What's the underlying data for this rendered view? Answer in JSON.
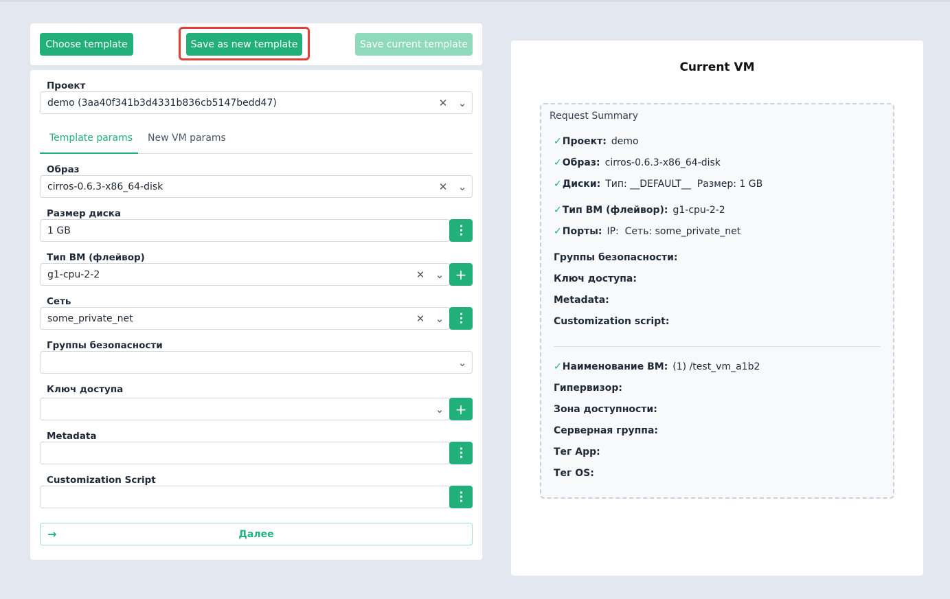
{
  "toolbar": {
    "choose_label": "Choose template",
    "save_as_new_label": "Save as new template",
    "save_current_label": "Save current template"
  },
  "form": {
    "project": {
      "label": "Проект",
      "value": "demo (3aa40f341b3d4331b836cb5147bedd47)"
    },
    "tabs": [
      {
        "label": "Template params",
        "active": true
      },
      {
        "label": "New VM params",
        "active": false
      }
    ],
    "image": {
      "label": "Образ",
      "value": "cirros-0.6.3-x86_64-disk"
    },
    "disk_size": {
      "label": "Размер диска",
      "value": "1 GB"
    },
    "flavor": {
      "label": "Тип ВМ (флейвор)",
      "value": "g1-cpu-2-2"
    },
    "network": {
      "label": "Сеть",
      "value": "some_private_net"
    },
    "security_groups": {
      "label": "Группы безопасности",
      "value": ""
    },
    "access_key": {
      "label": "Ключ доступа",
      "value": ""
    },
    "metadata": {
      "label": "Metadata",
      "value": ""
    },
    "customization": {
      "label": "Customization Script",
      "value": ""
    },
    "next_label": "Далее"
  },
  "summary": {
    "title": "Current VM",
    "box_title": "Request Summary",
    "rows": [
      {
        "checked": true,
        "key": "Проект:",
        "value": "demo"
      },
      {
        "checked": true,
        "key": "Образ:",
        "value": "cirros-0.6.3-x86_64-disk"
      },
      {
        "checked": true,
        "key": "Диски:",
        "value": "Тип: __DEFAULT__  Размер: 1 GB"
      },
      {
        "checked": true,
        "key": "Тип ВМ (флейвор):",
        "value": "g1-cpu-2-2"
      },
      {
        "checked": true,
        "key": "Порты:",
        "value": "IP:  Сеть: some_private_net"
      },
      {
        "checked": false,
        "key": "Группы безопасности:",
        "value": ""
      },
      {
        "checked": false,
        "key": "Ключ доступа:",
        "value": ""
      },
      {
        "checked": false,
        "key": "Metadata:",
        "value": ""
      },
      {
        "checked": false,
        "key": "Customization script:",
        "value": ""
      },
      {
        "checked": true,
        "key": "Наименование ВМ:",
        "value": "(1) /test_vm_a1b2"
      },
      {
        "checked": false,
        "key": "Гипервизор:",
        "value": ""
      },
      {
        "checked": false,
        "key": "Зона доступности:",
        "value": ""
      },
      {
        "checked": false,
        "key": "Серверная группа:",
        "value": ""
      },
      {
        "checked": false,
        "key": "Тег App:",
        "value": ""
      },
      {
        "checked": false,
        "key": "Тег OS:",
        "value": ""
      }
    ]
  },
  "colors": {
    "accent": "#21b07a",
    "highlight": "#e0403a"
  }
}
